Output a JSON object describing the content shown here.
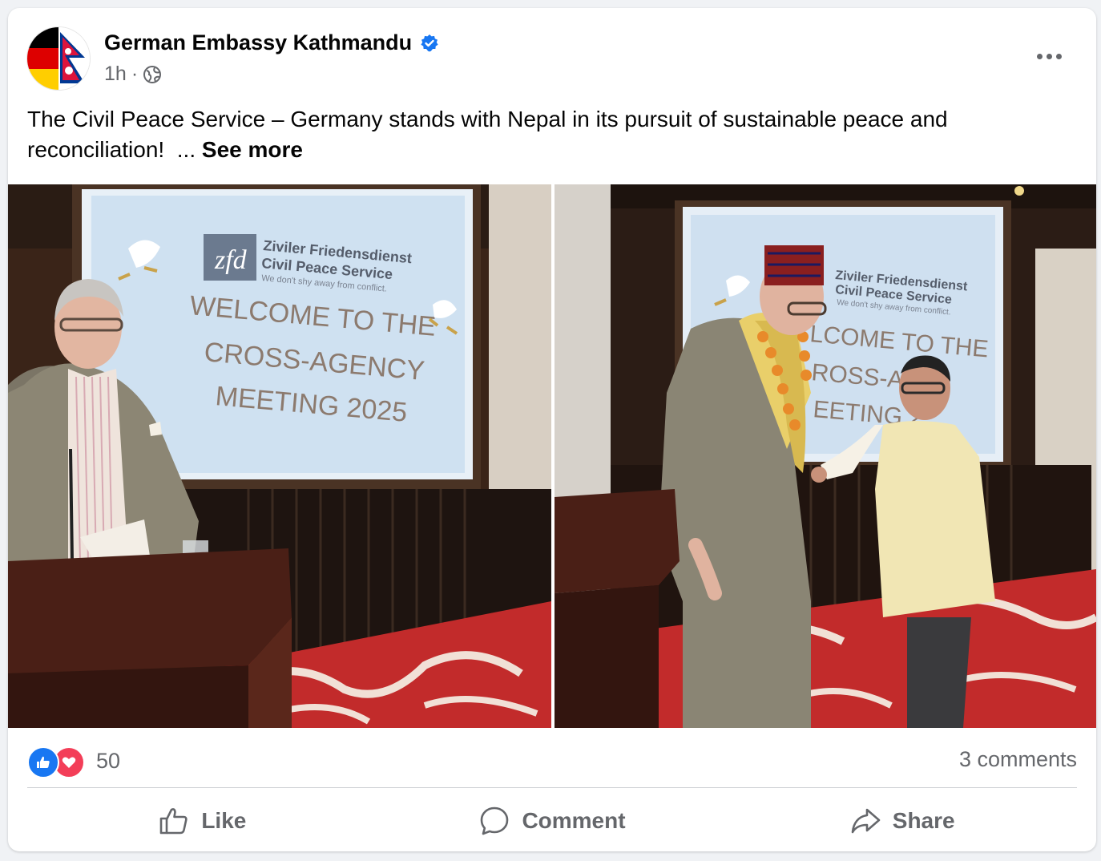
{
  "post": {
    "page_name": "German Embassy Kathmandu",
    "verified_icon": "verified-badge-icon",
    "time": "1h",
    "separator": "·",
    "audience_icon": "globe-icon",
    "text": "The Civil Peace Service – Germany stands with Nepal in its pursuit of sustainable peace and reconciliation!",
    "ellipsis": "...",
    "see_more": "See more"
  },
  "photos": [
    {
      "logo_text": "zfd",
      "org_line1": "Ziviler Friedensdienst",
      "org_line2": "Civil Peace Service",
      "tagline": "We don't shy away from conflict.",
      "slide_line1": "WELCOME TO THE",
      "slide_line2": "CROSS-AGENCY",
      "slide_line3": "MEETING 2025"
    },
    {
      "org_line1": "Ziviler Friedensdienst",
      "org_line2": "Civil Peace Service",
      "tagline": "We don't shy away from conflict.",
      "slide_line1": "LCOME TO THE",
      "slide_line2": "ROSS-AGE",
      "slide_line3": "EETING 2"
    }
  ],
  "stats": {
    "reaction_count": "50",
    "comments": "3 comments"
  },
  "actions": {
    "like": "Like",
    "comment": "Comment",
    "share": "Share"
  },
  "colors": {
    "accent": "#1877f2",
    "love": "#f33e58",
    "secondary_text": "#65676b"
  }
}
